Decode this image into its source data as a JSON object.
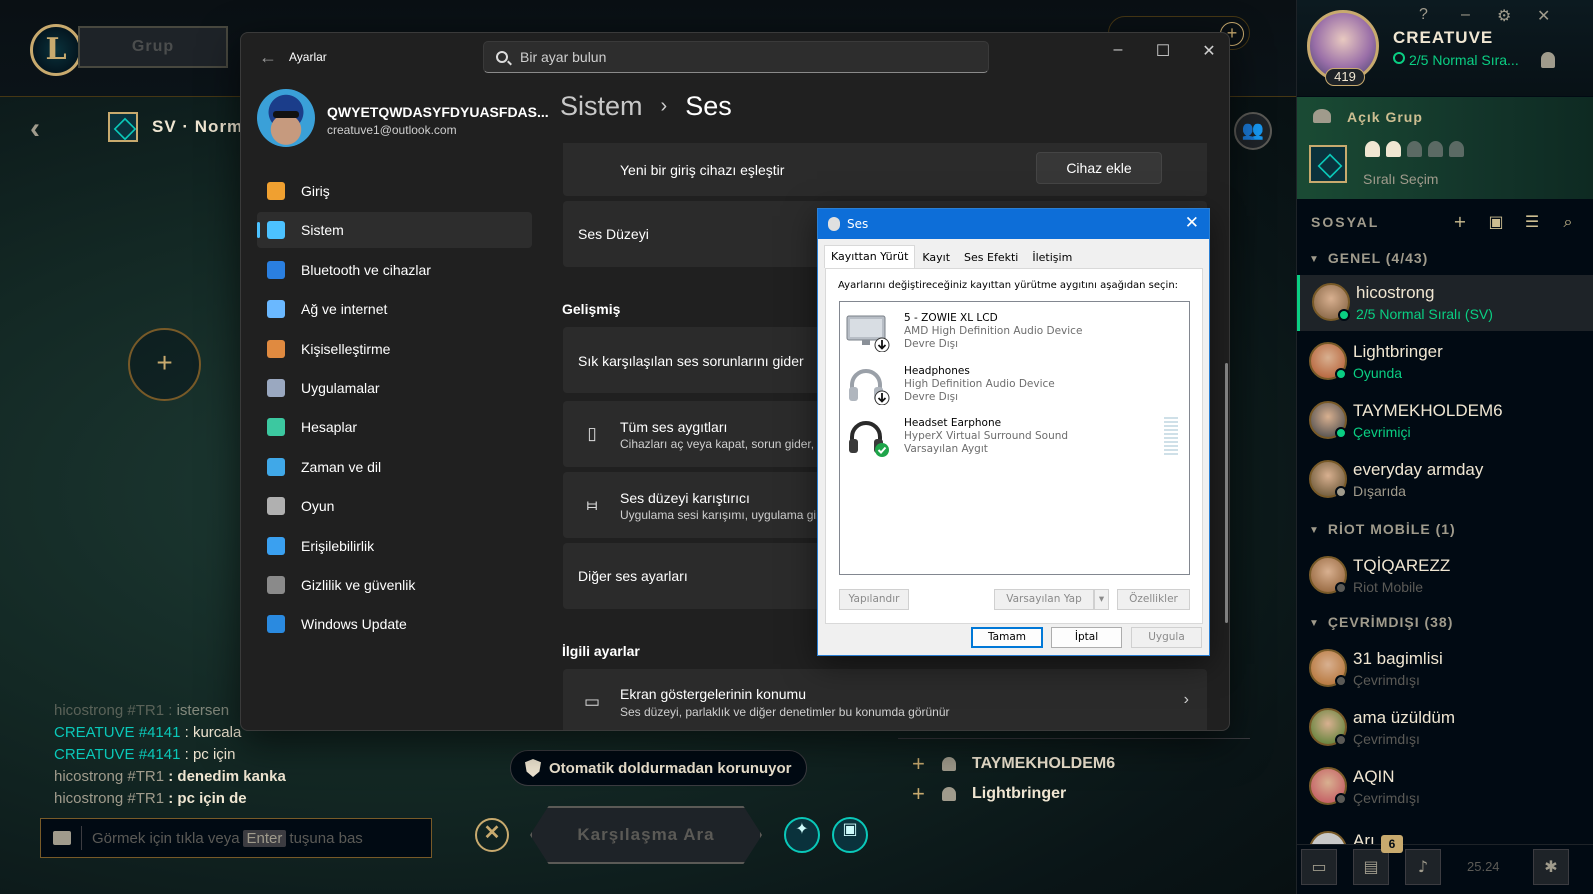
{
  "lol": {
    "play_label": "Grup",
    "mode_text": "SV · Norm",
    "invite_plus": "+",
    "chat": [
      {
        "name": "hicostrong #TR1",
        "sep": " : ",
        "msg": "istersen",
        "style": "cut"
      },
      {
        "name": "CREATUVE #4141",
        "sep": " : ",
        "msg": "kurcala",
        "style": "cyan"
      },
      {
        "name": "CREATUVE #4141",
        "sep": " : ",
        "msg": "pc için",
        "style": "cyan"
      },
      {
        "name": "hicostrong #TR1",
        "sep": " : ",
        "msg": "denedim kanka",
        "style": "bold"
      },
      {
        "name": "hicostrong #TR1",
        "sep": " : ",
        "msg": "pc için de",
        "style": "bold"
      }
    ],
    "chat_input": {
      "before": "Görmek için tıkla veya",
      "key": "Enter",
      "after": "tuşuna bas"
    },
    "autofill": "Otomatik doldurmadan korunuyor",
    "find_match": "Karşılaşma Ara",
    "close_symbol": "✕",
    "party_members": [
      "TAYMEKHOLDEM6",
      "Lightbringer"
    ]
  },
  "social": {
    "profile": {
      "name": "CREATUVE",
      "status": "2/5 Normal Sıra...",
      "level": "419"
    },
    "window_controls": [
      "?",
      "–",
      "⚙",
      "✕"
    ],
    "lobby": {
      "title": "Açık Grup",
      "subtitle": "Sıralı Seçim",
      "filled": 2,
      "total": 5
    },
    "header": "SOSYAL",
    "groups": [
      {
        "label": "GENEL (4/43)"
      },
      {
        "label": "RİOT MOBİLE (1)"
      },
      {
        "label": "ÇEVRİMDIŞI (38)"
      }
    ],
    "friends_general": [
      {
        "name": "hicostrong",
        "status": "2/5 Normal Sıralı (SV)",
        "status_color": "#0acf83",
        "avatar": "#7a5a3a"
      },
      {
        "name": "Lightbringer",
        "status": "Oyunda",
        "status_color": "#0acf83",
        "avatar": "#b0542a"
      },
      {
        "name": "TAYMEKHOLDEM6",
        "status": "Çevrimiçi",
        "status_color": "#0acf83",
        "avatar": "#3a3f44"
      },
      {
        "name": "everyday armday",
        "status": "Dışarıda",
        "status_color": "#a09b8c",
        "avatar": "#5a4a2a"
      }
    ],
    "friends_mobile": [
      {
        "name": "TQİQAREZZ",
        "status": "Riot Mobile",
        "status_color": "#5b5a56",
        "avatar": "#8a5a30"
      }
    ],
    "friends_offline": [
      {
        "name": "31 bagimlisi",
        "status": "Çevrimdışı",
        "status_color": "#5b5a56",
        "avatar": "#b06a2a"
      },
      {
        "name": "ama üzüldüm",
        "status": "Çevrimdışı",
        "status_color": "#5b5a56",
        "avatar": "#4a7a2a"
      },
      {
        "name": "AQIN",
        "status": "Çevrimdışı",
        "status_color": "#5b5a56",
        "avatar": "#c04a5a"
      }
    ],
    "partial_friend": "Arı",
    "badge_count": "6",
    "version": "25.24"
  },
  "settings": {
    "window_title": "Ayarlar",
    "search_placeholder": "Bir ayar bulun",
    "account": {
      "name": "QWYETQWDASYFDYUASFDAS...",
      "email": "creatuve1@outlook.com"
    },
    "nav": [
      {
        "label": "Giriş",
        "color": "#f0a030"
      },
      {
        "label": "Sistem",
        "color": "#4cc2ff"
      },
      {
        "label": "Bluetooth ve cihazlar",
        "color": "#2a7fe0"
      },
      {
        "label": "Ağ ve internet",
        "color": "#6ab8ff"
      },
      {
        "label": "Kişiselleştirme",
        "color": "#e08a40"
      },
      {
        "label": "Uygulamalar",
        "color": "#9aa8c0"
      },
      {
        "label": "Hesaplar",
        "color": "#3cc8a0"
      },
      {
        "label": "Zaman ve dil",
        "color": "#40a8e8"
      },
      {
        "label": "Oyun",
        "color": "#b0b0b0"
      },
      {
        "label": "Erişilebilirlik",
        "color": "#3aa0f0"
      },
      {
        "label": "Gizlilik ve güvenlik",
        "color": "#8a8a8a"
      },
      {
        "label": "Windows Update",
        "color": "#2a8ae0"
      }
    ],
    "breadcrumb": {
      "parent": "Sistem",
      "sep": "›",
      "current": "Ses"
    },
    "pair_input": {
      "label": "Yeni bir giriş cihazı eşleştir",
      "button": "Cihaz ekle"
    },
    "volume_label": "Ses Düzeyi",
    "advanced_header": "Gelişmiş",
    "troubleshoot": "Sık karşılaşılan ses sorunlarını gider",
    "all_devices": {
      "title": "Tüm ses aygıtları",
      "sub": "Cihazları aç veya kapat, sorun gider, o"
    },
    "mixer": {
      "title": "Ses düzeyi karıştırıcı",
      "sub": "Uygulama sesi karışımı, uygulama gir"
    },
    "more_sound": "Diğer ses ayarları",
    "related_header": "İlgili ayarlar",
    "display_overlay": {
      "title": "Ekran göstergelerinin konumu",
      "sub": "Ses düzeyi, parlaklık ve diğer denetimler bu konumda görünür"
    }
  },
  "sound_dialog": {
    "title": "Ses",
    "tabs": [
      "Kayıttan Yürüt",
      "Kayıt",
      "Ses Efekti",
      "İletişim"
    ],
    "instruction": "Ayarlarını değiştireceğiniz kayıttan yürütme aygıtını aşağıdan seçin:",
    "devices": [
      {
        "name": "5 - ZOWIE XL LCD",
        "driver": "AMD High Definition Audio Device",
        "state": "Devre Dışı",
        "icon": "monitor-icon"
      },
      {
        "name": "Headphones",
        "driver": "High Definition Audio Device",
        "state": "Devre Dışı",
        "icon": "headphones-icon"
      },
      {
        "name": "Headset Earphone",
        "driver": "HyperX Virtual Surround Sound",
        "state": "Varsayılan Aygıt",
        "icon": "headset-icon"
      }
    ],
    "buttons": {
      "configure": "Yapılandır",
      "set_default": "Varsayılan Yap",
      "properties": "Özellikler",
      "ok": "Tamam",
      "cancel": "İptal",
      "apply": "Uygula"
    }
  }
}
